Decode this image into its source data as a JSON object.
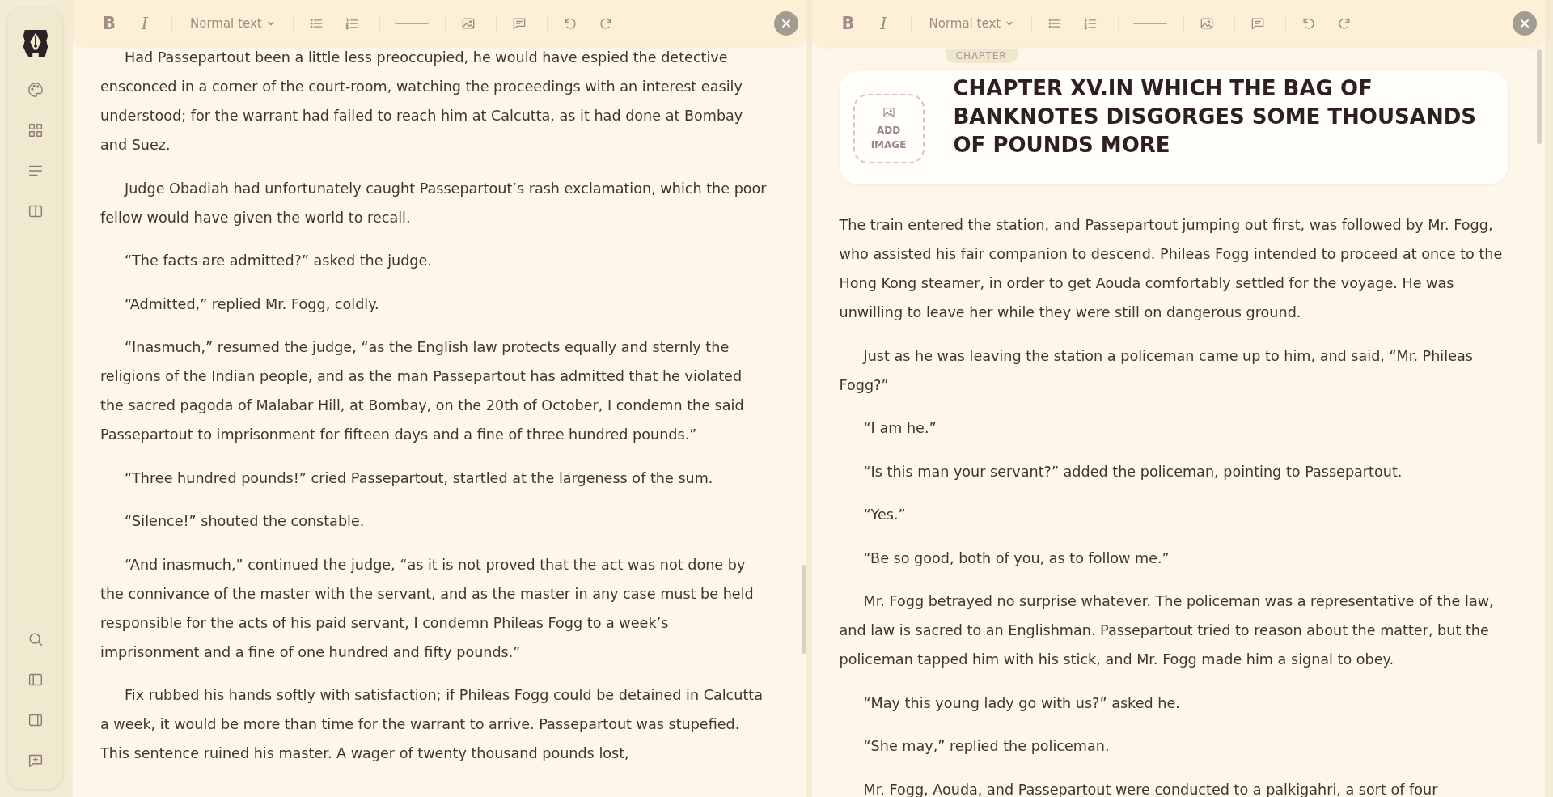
{
  "panes": [
    {
      "toolbar": {
        "bold": "B",
        "italic": "I",
        "style": "Normal text"
      },
      "paragraphs": [
        {
          "text": "Had Passepartout been a little less preoccupied, he would have espied the detective ensconced in a corner of the court-room, watching the proceedings with an interest easily understood; for the warrant had failed to reach him at Calcutta, as it had done at Bombay and Suez.",
          "indent": true
        },
        {
          "text": "Judge Obadiah had unfortunately caught Passepartout’s rash exclamation, which the poor fellow would have given the world to recall.",
          "indent": true
        },
        {
          "text": "“The facts are admitted?” asked the judge.",
          "indent": true
        },
        {
          "text": "“Admitted,” replied Mr. Fogg, coldly.",
          "indent": true
        },
        {
          "text": "“Inasmuch,” resumed the judge, “as the English law protects equally and sternly the religions of the Indian people, and as the man Passepartout has admitted that he violated the sacred pagoda of Malabar Hill, at Bombay, on the 20th of October, I condemn the said Passepartout to imprisonment for fifteen days and a fine of three hundred pounds.”",
          "indent": true
        },
        {
          "text": "“Three hundred pounds!” cried Passepartout, startled at the largeness of the sum.",
          "indent": true
        },
        {
          "text": "“Silence!” shouted the constable.",
          "indent": true
        },
        {
          "text": "“And inasmuch,” continued the judge, “as it is not proved that the act was not done by the connivance of the master with the servant, and as the master in any case must be held responsible for the acts of his paid servant, I condemn Phileas Fogg to a week’s imprisonment and a fine of one hundred and fifty pounds.”",
          "indent": true
        },
        {
          "text": "Fix rubbed his hands softly with satisfaction; if Phileas Fogg could be detained in Calcutta a week, it would be more than time for the warrant to arrive. Passepartout was stupefied. This sentence ruined his master. A wager of twenty thousand pounds lost,",
          "indent": true
        }
      ]
    },
    {
      "toolbar": {
        "bold": "B",
        "italic": "I",
        "style": "Normal text"
      },
      "header": {
        "badge": "CHAPTER",
        "add_image": "ADD IMAGE",
        "title": "CHAPTER XV.IN WHICH THE BAG OF BANKNOTES DISGORGES SOME THOUSANDS OF POUNDS MORE"
      },
      "paragraphs": [
        {
          "text": "The train entered the station, and Passepartout jumping out first, was followed by Mr. Fogg, who assisted his fair companion to descend. Phileas Fogg intended to proceed at once to the Hong Kong steamer, in order to get Aouda comfortably settled for the voyage. He was unwilling to leave her while they were still on dangerous ground.",
          "indent": false
        },
        {
          "text": "Just as he was leaving the station a policeman came up to him, and said, “Mr. Phileas Fogg?”",
          "indent": true
        },
        {
          "text": "“I am he.”",
          "indent": true
        },
        {
          "text": "“Is this man your servant?” added the policeman, pointing to Passepartout.",
          "indent": true
        },
        {
          "text": "“Yes.”",
          "indent": true
        },
        {
          "text": "“Be so good, both of you, as to follow me.”",
          "indent": true
        },
        {
          "text": "Mr. Fogg betrayed no surprise whatever. The policeman was a representative of the law, and law is sacred to an Englishman. Passepartout tried to reason about the matter, but the policeman tapped him with his stick, and Mr. Fogg made him a signal to obey.",
          "indent": true
        },
        {
          "text": "“May this young lady go with us?” asked he.",
          "indent": true
        },
        {
          "text": "“She may,” replied the policeman.",
          "indent": true
        },
        {
          "text": "Mr. Fogg, Aouda, and Passepartout were conducted to a palkigahri, a sort of four",
          "indent": true
        }
      ]
    }
  ]
}
